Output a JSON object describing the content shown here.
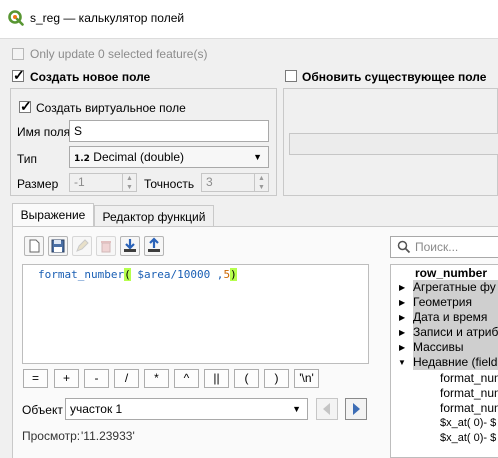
{
  "window": {
    "title": "s_reg — калькулятор полей"
  },
  "only_update_selected": {
    "label": "Only update 0 selected feature(s)",
    "checked": false
  },
  "create_field": {
    "label": "Создать новое поле",
    "checked": true,
    "virtual_label": "Создать виртуальное поле",
    "virtual_checked": true,
    "name_label": "Имя поля",
    "name_value": "S",
    "type_label": "Тип",
    "type_badge": "1.2",
    "type_value": "Decimal (double)",
    "size_label": "Размер",
    "size_value": "-1",
    "precision_label": "Точность",
    "precision_value": "3"
  },
  "update_field": {
    "label": "Обновить существующее поле",
    "checked": false
  },
  "tabs": [
    {
      "label": "Выражение"
    },
    {
      "label": "Редактор функций"
    }
  ],
  "toolbar": {
    "icons": [
      "new-file-icon",
      "save-icon",
      "edit-icon",
      "delete-icon",
      "import-icon",
      "export-icon"
    ]
  },
  "expression": {
    "func": "format_number",
    "open": "(",
    "args": " $area/10000 ,",
    "arg2": "5",
    "close": ")"
  },
  "operators": [
    "=",
    "+",
    "-",
    "/",
    "*",
    "^",
    "||",
    "(",
    ")",
    "'\\n'"
  ],
  "feature": {
    "label": "Объект",
    "value": "участок 1"
  },
  "preview": {
    "label": "Просмотр:",
    "value": "'11.23933'"
  },
  "search": {
    "placeholder": "Поиск..."
  },
  "tree": {
    "header": "row_number",
    "groups": [
      "Агрегатные фу",
      "Геометрия",
      "Дата и время",
      "Записи и атриб",
      "Массивы",
      "Недавние (field"
    ],
    "recent": [
      "format_num",
      "format_num",
      "format_num",
      "$x_at( 0)- $",
      "$x_at( 0)- $"
    ]
  },
  "colors": {
    "accent": "#1a5fb4",
    "highlight": "#cfcfcf",
    "qgis_green": "#589632",
    "bracket_match": "#b6ff4d"
  }
}
